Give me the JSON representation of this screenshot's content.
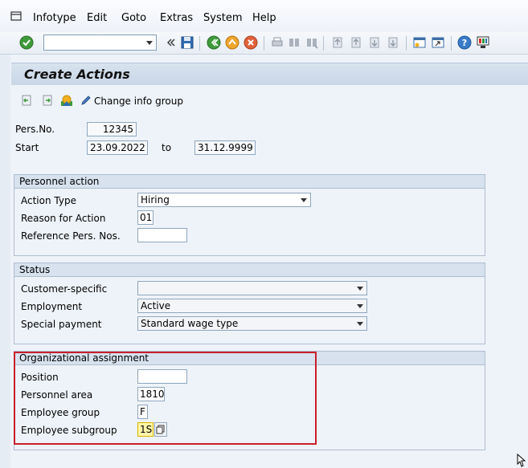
{
  "menu": {
    "items": [
      "Infotype",
      "Edit",
      "Goto",
      "Extras",
      "System",
      "Help"
    ]
  },
  "toolbar": {
    "command_value": "",
    "icons": [
      "enter-check-icon",
      "command-dropdown-icon",
      "collapse-icon",
      "save-icon",
      "back-icon",
      "exit-icon",
      "cancel-icon",
      "print-icon",
      "find-icon",
      "find-next-icon",
      "first-page-icon",
      "prev-page-icon",
      "next-page-icon",
      "last-page-icon",
      "new-session-icon",
      "shortcut-icon",
      "help-icon",
      "customize-layout-icon"
    ]
  },
  "title": "Create Actions",
  "app_toolbar": {
    "change_info_group_label": "Change info group"
  },
  "header": {
    "pers_no_label": "Pers.No.",
    "pers_no_value": "12345",
    "start_label": "Start",
    "start_value": "23.09.2022",
    "to_label": "to",
    "end_value": "31.12.9999"
  },
  "personnel_action": {
    "heading": "Personnel action",
    "action_type_label": "Action Type",
    "action_type_value": "Hiring",
    "reason_label": "Reason for Action",
    "reason_value": "01",
    "ref_pers_label": "Reference Pers. Nos.",
    "ref_pers_value": ""
  },
  "status": {
    "heading": "Status",
    "customer_label": "Customer-specific",
    "customer_value": "",
    "employment_label": "Employment",
    "employment_value": "Active",
    "special_label": "Special payment",
    "special_value": "Standard wage type"
  },
  "org_assignment": {
    "heading": "Organizational assignment",
    "position_label": "Position",
    "position_value": "",
    "area_label": "Personnel area",
    "area_value": "1810",
    "group_label": "Employee group",
    "group_value": "F",
    "subgroup_label": "Employee subgroup",
    "subgroup_value": "1S"
  },
  "colors": {
    "highlight": "#c8202b",
    "background": "#eef3f9",
    "group_header": "#d7e2ee"
  }
}
